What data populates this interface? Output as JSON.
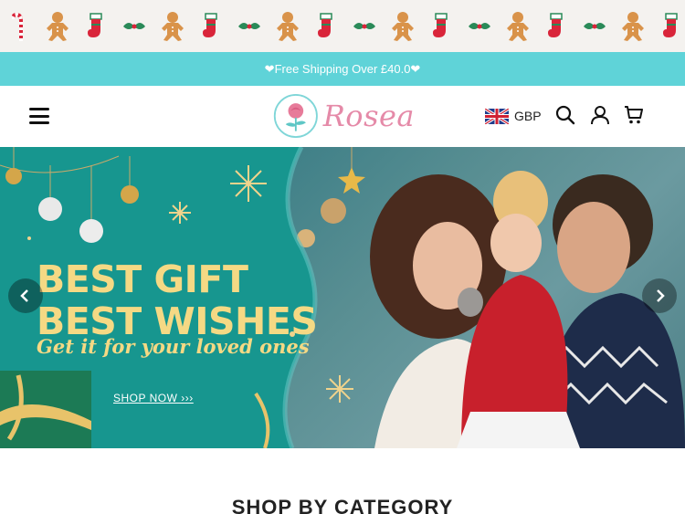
{
  "festive_strip": {
    "items": [
      "candy-cane-icon",
      "gingerbread-icon",
      "stocking-icon",
      "holly-icon",
      "gingerbread-icon",
      "stocking-icon",
      "holly-icon",
      "gingerbread-icon",
      "stocking-icon",
      "holly-icon",
      "gingerbread-icon",
      "stocking-icon",
      "holly-icon",
      "gingerbread-icon",
      "stocking-icon",
      "holly-icon",
      "gingerbread-icon",
      "stocking-icon"
    ]
  },
  "announcement": {
    "text": "❤Free Shipping Over £40.0❤",
    "bg_color": "#5fd3d8"
  },
  "header": {
    "logo_text": "Rosea",
    "currency": "GBP",
    "icons": [
      "menu-icon",
      "uk-flag-icon",
      "search-icon",
      "account-icon",
      "cart-icon"
    ]
  },
  "hero": {
    "title_line1": "BEST GIFT",
    "title_line2": "BEST WISHES",
    "subtitle": "Get it for your loved ones",
    "cta": "SHOP NOW ›››",
    "accent_color": "#f5d984",
    "teal_color": "#17968f"
  },
  "sections": {
    "category_title": "SHOP BY CATEGORY"
  }
}
